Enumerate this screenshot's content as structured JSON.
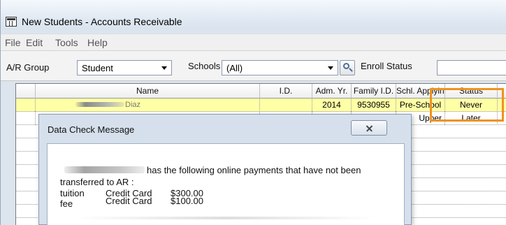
{
  "window": {
    "title": "New Students - Accounts Receivable"
  },
  "menu": [
    "File",
    "Edit",
    "Tools",
    "Help"
  ],
  "filters": {
    "ar_group_label": "A/R Group",
    "ar_group_value": "Student",
    "schools_label": "Schools",
    "schools_value": "(All)",
    "enroll_status_label": "Enroll Status"
  },
  "grid": {
    "columns": [
      "Name",
      "I.D.",
      "Adm. Yr.",
      "Family I.D.",
      "Schl. Applying",
      "Status"
    ],
    "rows": [
      {
        "name_suffix": "Diaz",
        "id": "",
        "adm_yr": "2014",
        "family_id": "9530955",
        "school": "Pre-School",
        "status": "Never"
      },
      {
        "name_suffix": "",
        "id": "",
        "adm_yr": "",
        "family_id": "",
        "school": "Upper",
        "status": "Later"
      }
    ]
  },
  "dialog": {
    "title": "Data Check Message",
    "message_line1": "has the following online payments that have not been",
    "message_line2": "transferred to AR :",
    "payments": [
      {
        "type": "tuition",
        "method": "Credit Card",
        "amount": "$300.00"
      },
      {
        "type": "fee",
        "method": "Credit Card",
        "amount": "$100.00"
      }
    ]
  },
  "colors": {
    "selected_row": "#ffffa6",
    "highlight_box": "#f0921e"
  }
}
